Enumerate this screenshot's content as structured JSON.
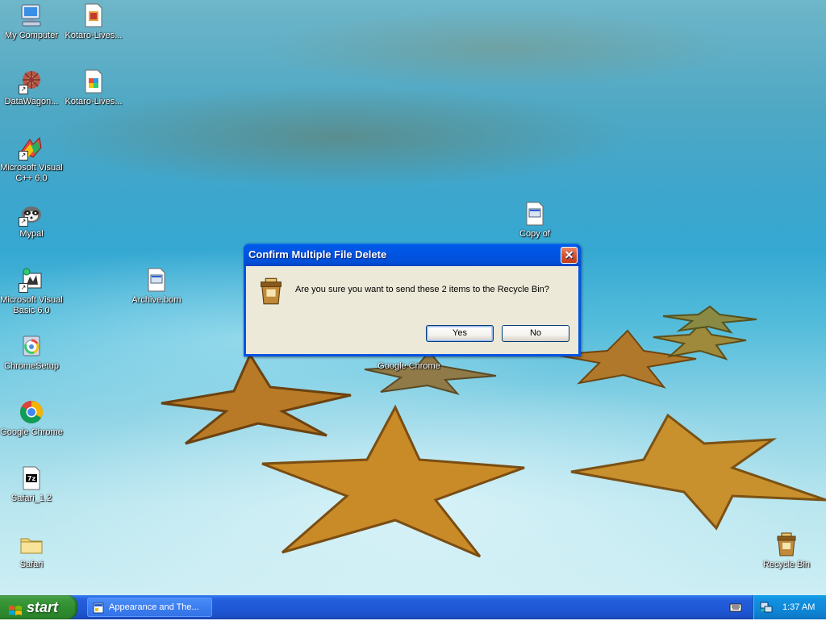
{
  "desktop_icons": [
    {
      "label": "My Computer",
      "icon": "computer-icon"
    },
    {
      "label": "Kotaro-Lives...",
      "icon": "document-icon"
    },
    {
      "label": "DataWagon...",
      "icon": "datawagon-icon"
    },
    {
      "label": "Kotaro-Lives...",
      "icon": "document-icon"
    },
    {
      "label": "Microsoft Visual C++ 6.0",
      "icon": "visual-cpp-icon"
    },
    {
      "label": "Mypal",
      "icon": "mypal-icon"
    },
    {
      "label": "Copy of",
      "icon": "file-icon"
    },
    {
      "label": "Microsoft Visual Basic 6.0",
      "icon": "visual-basic-icon"
    },
    {
      "label": "Archive.bom",
      "icon": "file-icon"
    },
    {
      "label": "ChromeSetup",
      "icon": "setup-icon"
    },
    {
      "label": "Google Chrome",
      "icon": "chrome-icon"
    },
    {
      "label": "Google Chrome",
      "icon": "chrome-icon"
    },
    {
      "label": "Safari_1.2",
      "icon": "7z-archive-icon"
    },
    {
      "label": "Safari",
      "icon": "folder-icon"
    },
    {
      "label": "Recycle Bin",
      "icon": "recycle-bin-icon"
    }
  ],
  "dialog": {
    "title": "Confirm Multiple File Delete",
    "message": "Are you sure you want to send these 2 items to the Recycle Bin?",
    "yes_label": "Yes",
    "no_label": "No",
    "close_symbol": "✕"
  },
  "taskbar": {
    "start_label": "start",
    "task_item_label": "Appearance and The...",
    "clock": "1:37 AM"
  },
  "colors": {
    "titlebar": "#0054e3",
    "taskbar": "#245edb",
    "start_button": "#3c9a3c",
    "dialog_body": "#ece9d8"
  }
}
